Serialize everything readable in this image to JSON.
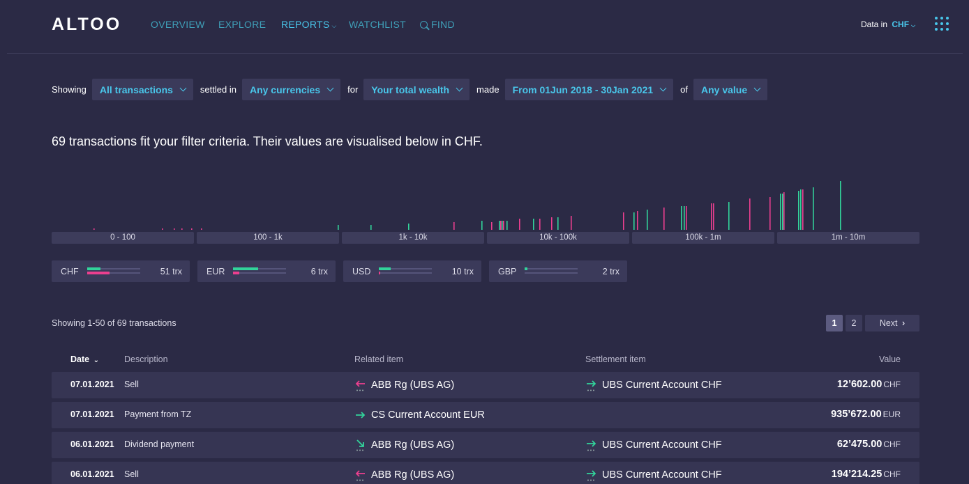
{
  "nav": {
    "logo": "ALTOO",
    "links": [
      "OVERVIEW",
      "EXPLORE",
      "REPORTS",
      "WATCHLIST",
      "FIND"
    ],
    "active": "REPORTS",
    "data_in_label": "Data in",
    "currency": "CHF"
  },
  "filters": {
    "showing_label": "Showing",
    "transactions": "All transactions",
    "settled_label": "settled in",
    "currencies": "Any currencies",
    "for_label": "for",
    "scope": "Your total wealth",
    "made_label": "made",
    "period": "From 01Jun 2018 - 30Jan 2021",
    "of_label": "of",
    "value": "Any value"
  },
  "summary": "69 transactions fit your filter criteria. Their values are visualised below in CHF.",
  "chart_data": {
    "type": "bar",
    "buckets": [
      "0 - 100",
      "100 - 1k",
      "1k - 10k",
      "10k - 100k",
      "100k - 1m",
      "1m - 10m"
    ],
    "note_colors": {
      "inflow": "#32d49b",
      "outflow": "#ec3f8f"
    }
  },
  "currency_chips": [
    {
      "code": "CHF",
      "count": "51 trx",
      "green": 0.25,
      "pink": 0.42
    },
    {
      "code": "EUR",
      "count": "6 trx",
      "green": 0.47,
      "pink": 0.12
    },
    {
      "code": "USD",
      "count": "10 trx",
      "green": 0.22,
      "pink": 0.03
    },
    {
      "code": "GBP",
      "count": "2 trx",
      "green": 0.05,
      "pink": 0.0
    }
  ],
  "pagination": {
    "showing": "Showing 1-50 of 69 transactions",
    "pages": [
      "1",
      "2"
    ],
    "current": "1",
    "next": "Next"
  },
  "table": {
    "headers": {
      "date": "Date",
      "description": "Description",
      "related": "Related item",
      "settlement": "Settlement item",
      "value": "Value"
    },
    "rows": [
      {
        "date": "07.01.2021",
        "description": "Sell",
        "related": "ABB Rg (UBS AG)",
        "related_icon": "sell-arrow-icon",
        "settlement": "UBS Current Account CHF",
        "amount": "12’602.00",
        "currency": "CHF"
      },
      {
        "date": "07.01.2021",
        "description": "Payment from TZ",
        "related": "CS Current Account EUR",
        "related_icon": "incoming-arrow-icon",
        "settlement": "",
        "amount": "935’672.00",
        "currency": "EUR"
      },
      {
        "date": "06.01.2021",
        "description": "Dividend payment",
        "related": "ABB Rg (UBS AG)",
        "related_icon": "dividend-arrow-icon",
        "settlement": "UBS Current Account CHF",
        "amount": "62’475.00",
        "currency": "CHF"
      },
      {
        "date": "06.01.2021",
        "description": "Sell",
        "related": "ABB Rg (UBS AG)",
        "related_icon": "sell-arrow-icon",
        "settlement": "UBS Current Account CHF",
        "amount": "194’214.25",
        "currency": "CHF"
      }
    ]
  }
}
